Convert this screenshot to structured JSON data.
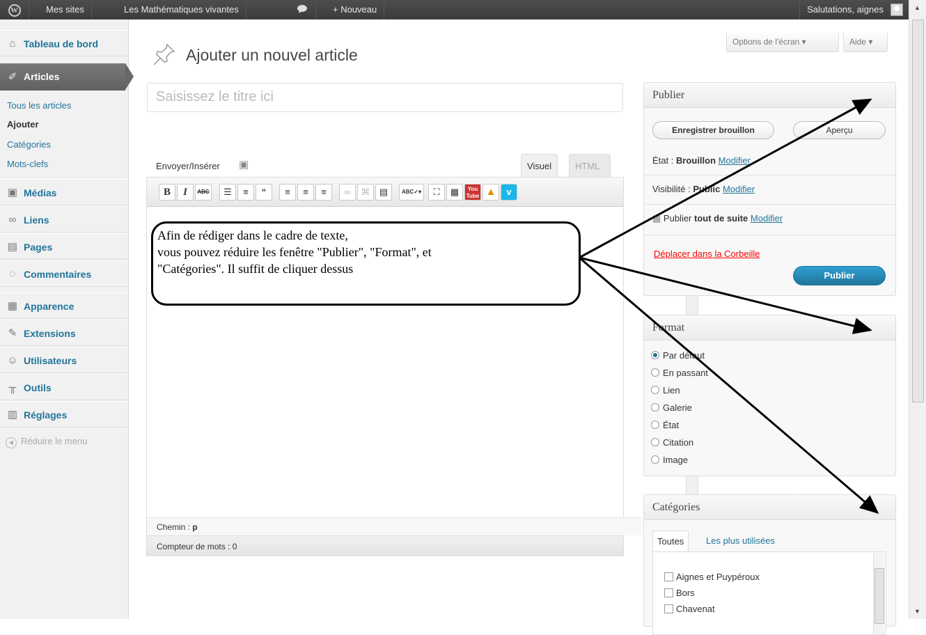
{
  "adminbar": {
    "wp_logo": "W",
    "my_sites": "Mes sites",
    "site_name": "Les Mathématiques vivantes",
    "comments_icon": "comment-icon",
    "new_label": "+ Nouveau",
    "greeting": "Salutations, aignes"
  },
  "menu": {
    "dashboard": "Tableau de bord",
    "articles": "Articles",
    "sub": [
      "Tous les articles",
      "Ajouter",
      "Catégories",
      "Mots-clefs"
    ],
    "medias": "Médias",
    "links": "Liens",
    "pages": "Pages",
    "comments": "Commentaires",
    "appearance": "Apparence",
    "extensions": "Extensions",
    "users": "Utilisateurs",
    "tools": "Outils",
    "settings": "Réglages",
    "collapse": "Réduire le menu"
  },
  "header": {
    "title": "Ajouter un nouvel article",
    "screen_options": "Options de l'écran ▾",
    "help": "Aide ▾"
  },
  "editor": {
    "title_placeholder": "Saisissez le titre ici",
    "media_label": "Envoyer/Insérer",
    "tab_visual": "Visuel",
    "tab_html": "HTML",
    "path_label": "Chemin :",
    "path_value": "p",
    "word_count": "Compteur de mots : 0"
  },
  "callout": {
    "line1": "Afin de rédiger dans le cadre de texte,",
    "line2": "vous pouvez réduire les fenêtre \"Publier\", \"Format\", et",
    "line3": "\"Catégories\". Il suffit de cliquer dessus"
  },
  "publish": {
    "title": "Publier",
    "save_draft": "Enregistrer brouillon",
    "preview": "Aperçu",
    "status_label": "État :",
    "status_value": "Brouillon",
    "visibility_label": "Visibilité :",
    "visibility_value": "Public",
    "publish_label": "Publier",
    "publish_value": "tout de suite",
    "modify": "Modifier",
    "trash": "Déplacer dans la Corbeille",
    "publish_button": "Publier"
  },
  "format": {
    "title": "Format",
    "options": [
      "Par défaut",
      "En passant",
      "Lien",
      "Galerie",
      "État",
      "Citation",
      "Image"
    ],
    "selected": "Par défaut"
  },
  "categories": {
    "title": "Catégories",
    "tab_all": "Toutes",
    "tab_popular": "Les plus utilisées",
    "items": [
      "Aignes et Puypéroux",
      "Bors",
      "Chavenat"
    ]
  }
}
